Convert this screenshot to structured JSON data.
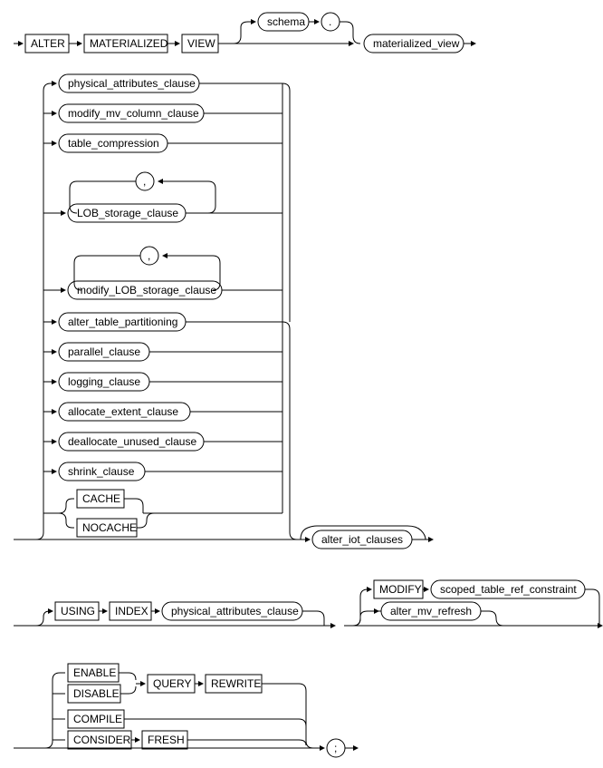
{
  "row1": {
    "alter": "ALTER",
    "materialized": "MATERIALIZED",
    "view": "VIEW",
    "schema": "schema",
    "dot": ".",
    "mv": "materialized_view"
  },
  "block2": {
    "phys": "physical_attributes_clause",
    "modcol": "modify_mv_column_clause",
    "tcomp": "table_compression",
    "comma1": ",",
    "lob": "LOB_storage_clause",
    "comma2": ",",
    "modlob": "modify_LOB_storage_clause",
    "atp": "alter_table_partitioning",
    "par": "parallel_clause",
    "log": "logging_clause",
    "alloc": "allocate_extent_clause",
    "dealloc": "deallocate_unused_clause",
    "shrink": "shrink_clause",
    "cache": "CACHE",
    "nocache": "NOCACHE",
    "aiot": "alter_iot_clauses"
  },
  "row3": {
    "using": "USING",
    "index": "INDEX",
    "phys": "physical_attributes_clause",
    "modify": "MODIFY",
    "scoped": "scoped_table_ref_constraint",
    "altref": "alter_mv_refresh"
  },
  "row4": {
    "enable": "ENABLE",
    "disable": "DISABLE",
    "query": "QUERY",
    "rewrite": "REWRITE",
    "compile": "COMPILE",
    "consider": "CONSIDER",
    "fresh": "FRESH",
    "semi": ";"
  }
}
